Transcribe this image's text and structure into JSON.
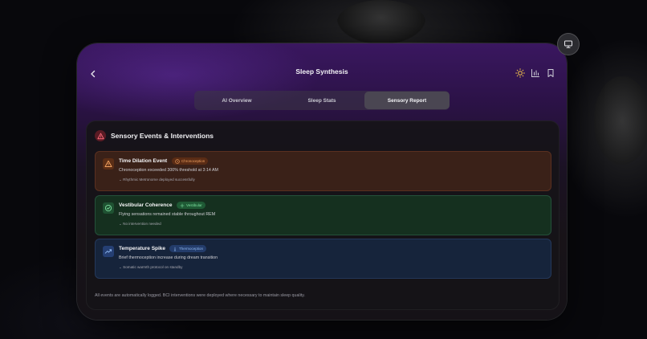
{
  "header": {
    "title": "Sleep Synthesis"
  },
  "tabs": [
    {
      "label": "AI Overview",
      "active": false
    },
    {
      "label": "Sleep Stats",
      "active": false
    },
    {
      "label": "Sensory Report",
      "active": true
    }
  ],
  "panel": {
    "title": "Sensory Events & Interventions",
    "events": [
      {
        "title": "Time Dilation Event",
        "badge": "Chronoception",
        "badge_icon": "clock-icon",
        "icon": "warning-triangle-icon",
        "description": "Chronoception exceeded 300% threshold at 3:14 AM",
        "note": "Rhythmic Metronome deployed successfully",
        "color": "#f0a060"
      },
      {
        "title": "Vestibular Coherence",
        "badge": "Vestibular",
        "badge_icon": "move-icon",
        "icon": "check-circle-icon",
        "description": "Flying sensations remained stable throughout REM",
        "note": "No intervention needed",
        "color": "#7ee0a0"
      },
      {
        "title": "Temperature Spike",
        "badge": "Thermoception",
        "badge_icon": "thermometer-icon",
        "icon": "trend-up-icon",
        "description": "Brief thermoception increase during dream transition",
        "note": "Somatic warmth protocol on standby",
        "color": "#8fb8f0"
      }
    ],
    "footer": "All events are automatically logged. BCI interventions were deployed where necessary to maintain sleep quality."
  },
  "colors": {
    "accent_sun": "#f5c54a",
    "accent_purple": "#3a1760"
  }
}
